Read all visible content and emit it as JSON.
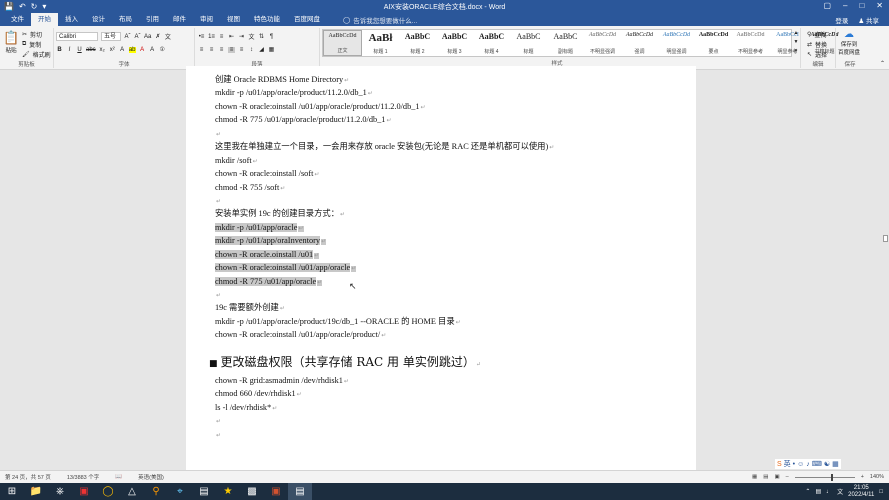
{
  "window": {
    "title": "AIX安装ORACLE综合文档.docx - Word"
  },
  "qat": {
    "save_icon": "save-icon",
    "undo_icon": "undo-icon",
    "redo_icon": "redo-icon"
  },
  "tabs": [
    {
      "label": "文件"
    },
    {
      "label": "开始"
    },
    {
      "label": "插入"
    },
    {
      "label": "设计"
    },
    {
      "label": "布局"
    },
    {
      "label": "引用"
    },
    {
      "label": "邮件"
    },
    {
      "label": "审阅"
    },
    {
      "label": "视图"
    },
    {
      "label": "特色功能"
    },
    {
      "label": "百度网盘"
    }
  ],
  "tell_me": "告诉我您想要做什么...",
  "account": {
    "login": "登录",
    "share": "共享"
  },
  "ribbon": {
    "clipboard": {
      "paste": "粘贴",
      "cut": "剪切",
      "copy": "复制",
      "painter": "格式刷",
      "label": "剪贴板"
    },
    "font": {
      "name": "Calibri",
      "size": "五号",
      "label": "字体"
    },
    "paragraph": {
      "label": "段落"
    },
    "styles": {
      "label": "样式",
      "items": [
        {
          "preview": "AaBbCcDd",
          "label": "正文"
        },
        {
          "preview": "AaBł",
          "label": "标题 1"
        },
        {
          "preview": "AaBbC",
          "label": "标题 2"
        },
        {
          "preview": "AaBbC",
          "label": "标题 3"
        },
        {
          "preview": "AaBbC",
          "label": "标题 4"
        },
        {
          "preview": "AaBbC",
          "label": "标题"
        },
        {
          "preview": "AaBbC",
          "label": "副标题"
        },
        {
          "preview": "AaBbCcDd",
          "label": "不明显强调"
        },
        {
          "preview": "AaBbCcDd",
          "label": "强调"
        },
        {
          "preview": "AaBbCcDd",
          "label": "明显强调"
        },
        {
          "preview": "AaBbCcDd",
          "label": "要点"
        },
        {
          "preview": "AaBbCcDd",
          "label": "不明显参考"
        },
        {
          "preview": "AaBbCcI",
          "label": "明显参考"
        },
        {
          "preview": "AaBbCcDd",
          "label": "书籍标题"
        }
      ]
    },
    "editing": {
      "find": "查找",
      "replace": "替换",
      "select": "选择",
      "label": "编辑"
    },
    "save": {
      "label1": "保存到",
      "label2": "百度网盘",
      "label": "保存"
    }
  },
  "document": {
    "lines": [
      {
        "text": "创建 Oracle RDBMS Home Directory"
      },
      {
        "text": "mkdir -p /u01/app/oracle/product/11.2.0/db_1"
      },
      {
        "text": "chown -R oracle:oinstall /u01/app/oracle/product/11.2.0/db_1"
      },
      {
        "text": "chmod -R 775 /u01/app/oracle/product/11.2.0/db_1"
      },
      {
        "text": ""
      },
      {
        "text": "这里我在单独建立一个目录，一会用来存放 oracle 安装包(无论是 RAC 还是单机都可以使用)"
      },
      {
        "text": "mkdir /soft"
      },
      {
        "text": "chown -R oracle:oinstall /soft"
      },
      {
        "text": "chmod -R 755 /soft"
      },
      {
        "text": ""
      },
      {
        "text": "安装单实例 19c 的创建目录方式："
      },
      {
        "text": "mkdir -p /u01/app/oracle"
      },
      {
        "text": "mkdir -p /u01/app/oraInventory"
      },
      {
        "text": "chown -R oracle.oinstall /u01"
      },
      {
        "text": "chown -R oracle:oinstall /u01/app/oracle"
      },
      {
        "text": "chmod -R 775 /u01/app/oracle"
      },
      {
        "text": ""
      },
      {
        "text": "19c 需要额外创建"
      },
      {
        "text": "mkdir -p /u01/app/oracle/product/19c/db_1        --ORACLE 的 HOME 目录"
      },
      {
        "text": "chown -R oracle:oinstall /u01/app/oracle/product/"
      }
    ],
    "heading": "更改磁盘权限（共享存储 RAC 用 单实例跳过）",
    "lines2": [
      {
        "text": "chown -R grid:asmadmin /dev/rhdisk1"
      },
      {
        "text": "chmod 660 /dev/rhdisk1"
      },
      {
        "text": "ls -l /dev/rhdisk*"
      },
      {
        "text": ""
      },
      {
        "text": ""
      }
    ]
  },
  "status": {
    "page": "第 24 页，共 57 页",
    "words": "13/3883 个字",
    "lang": "英语(美国)",
    "zoom": "140%"
  },
  "ime": {
    "label": "英"
  },
  "clock": {
    "time": "21:05",
    "date": "2022/4/11"
  }
}
